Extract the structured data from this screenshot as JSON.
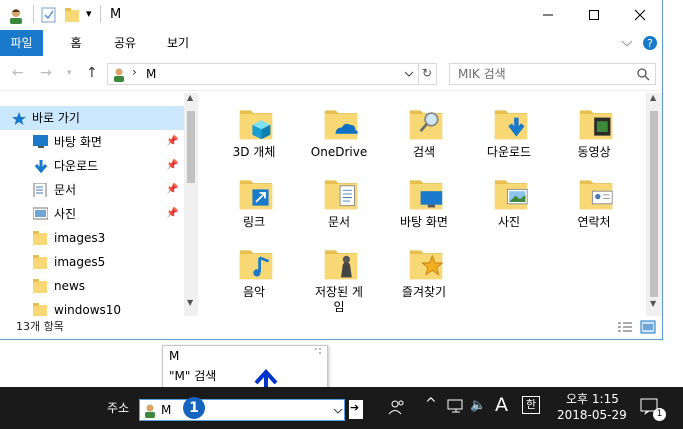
{
  "titlebar": {
    "title": "M",
    "qat_dropdown": "▾"
  },
  "ribbon": {
    "file": "파일",
    "home": "홈",
    "share": "공유",
    "view": "보기"
  },
  "nav": {
    "address_path": "M",
    "search_placeholder": "MIK 검색"
  },
  "sidebar": {
    "items": [
      {
        "label": "바로 가기",
        "icon": "star-icon",
        "pinned": false,
        "selected": true
      },
      {
        "label": "바탕 화면",
        "icon": "desktop-icon",
        "pinned": true
      },
      {
        "label": "다운로드",
        "icon": "download-icon",
        "pinned": true
      },
      {
        "label": "문서",
        "icon": "document-icon",
        "pinned": true
      },
      {
        "label": "사진",
        "icon": "picture-icon",
        "pinned": true
      },
      {
        "label": "images3",
        "icon": "folder-icon",
        "pinned": false
      },
      {
        "label": "images5",
        "icon": "folder-icon",
        "pinned": false
      },
      {
        "label": "news",
        "icon": "folder-icon",
        "pinned": false
      },
      {
        "label": "windows10",
        "icon": "folder-icon",
        "pinned": false
      }
    ]
  },
  "files": [
    {
      "label": "3D 개체",
      "icon": "3d-objects-folder-icon"
    },
    {
      "label": "OneDrive",
      "icon": "onedrive-folder-icon"
    },
    {
      "label": "검색",
      "icon": "search-folder-icon"
    },
    {
      "label": "다운로드",
      "icon": "downloads-folder-icon"
    },
    {
      "label": "동영상",
      "icon": "videos-folder-icon"
    },
    {
      "label": "링크",
      "icon": "links-folder-icon"
    },
    {
      "label": "문서",
      "icon": "documents-folder-icon"
    },
    {
      "label": "바탕 화면",
      "icon": "desktop-folder-icon"
    },
    {
      "label": "사진",
      "icon": "pictures-folder-icon"
    },
    {
      "label": "연락처",
      "icon": "contacts-folder-icon"
    },
    {
      "label": "음악",
      "icon": "music-folder-icon"
    },
    {
      "label": "저장된 게\n임",
      "icon": "saved-games-folder-icon"
    },
    {
      "label": "즐겨찾기",
      "icon": "favorites-folder-icon"
    }
  ],
  "status": {
    "item_count": "13개 항목"
  },
  "popup": {
    "line1": "M",
    "line2": "\"M\" 검색"
  },
  "taskbar": {
    "address_label": "주소",
    "address_value": "M",
    "badge": "1",
    "ime_mode": "A",
    "ime_hangul": "한",
    "time": "오후 1:15",
    "date": "2018-05-29",
    "notification_count": "1"
  },
  "colors": {
    "accent": "#1979ca",
    "folder": "#f8d775",
    "taskbar": "#1a1a1a",
    "badge": "#1565c0"
  }
}
